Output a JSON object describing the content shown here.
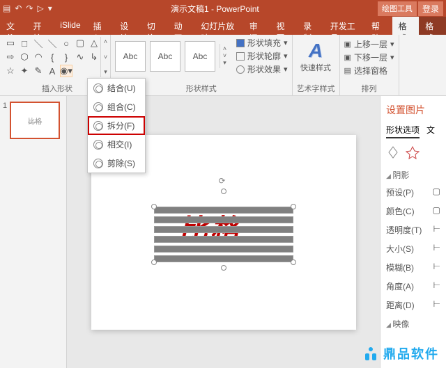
{
  "title": "演示文稿1 - PowerPoint",
  "titleRight": {
    "tool": "绘图工具",
    "login": "登录"
  },
  "tabs": [
    "文件",
    "开始",
    "iSlide",
    "插入",
    "设计",
    "切换",
    "动画",
    "幻灯片放映",
    "审阅",
    "视图",
    "录制",
    "开发工具",
    "帮助",
    "格式",
    "格式"
  ],
  "groups": {
    "insertShape": "插入形状",
    "shapeStyle": "形状样式",
    "wordart": "艺术字样式",
    "arrange": "排列"
  },
  "abc": "Abc",
  "shapeMenu": {
    "fill": "形状填充",
    "outline": "形状轮廓",
    "effect": "形状效果"
  },
  "quickStyle": "快速样式",
  "arrangeItems": {
    "up": "上移一层",
    "down": "下移一层",
    "select": "选择窗格"
  },
  "dropdown": {
    "union": "结合(U)",
    "combine": "组合(C)",
    "fragment": "拆分(F)",
    "intersect": "相交(I)",
    "subtract": "剪除(S)"
  },
  "thumbText": "比格",
  "slideText": "比格",
  "panel": {
    "title": "设置图片",
    "tab1": "形状选项",
    "tab2": "文",
    "sec1": "阴影",
    "rows": {
      "preset": "预设(P)",
      "color": "颜色(C)",
      "transparency": "透明度(T)",
      "size": "大小(S)",
      "blur": "模糊(B)",
      "angle": "角度(A)",
      "distance": "距离(D)"
    },
    "sec2": "映像"
  },
  "watermark": "鼎品软件"
}
